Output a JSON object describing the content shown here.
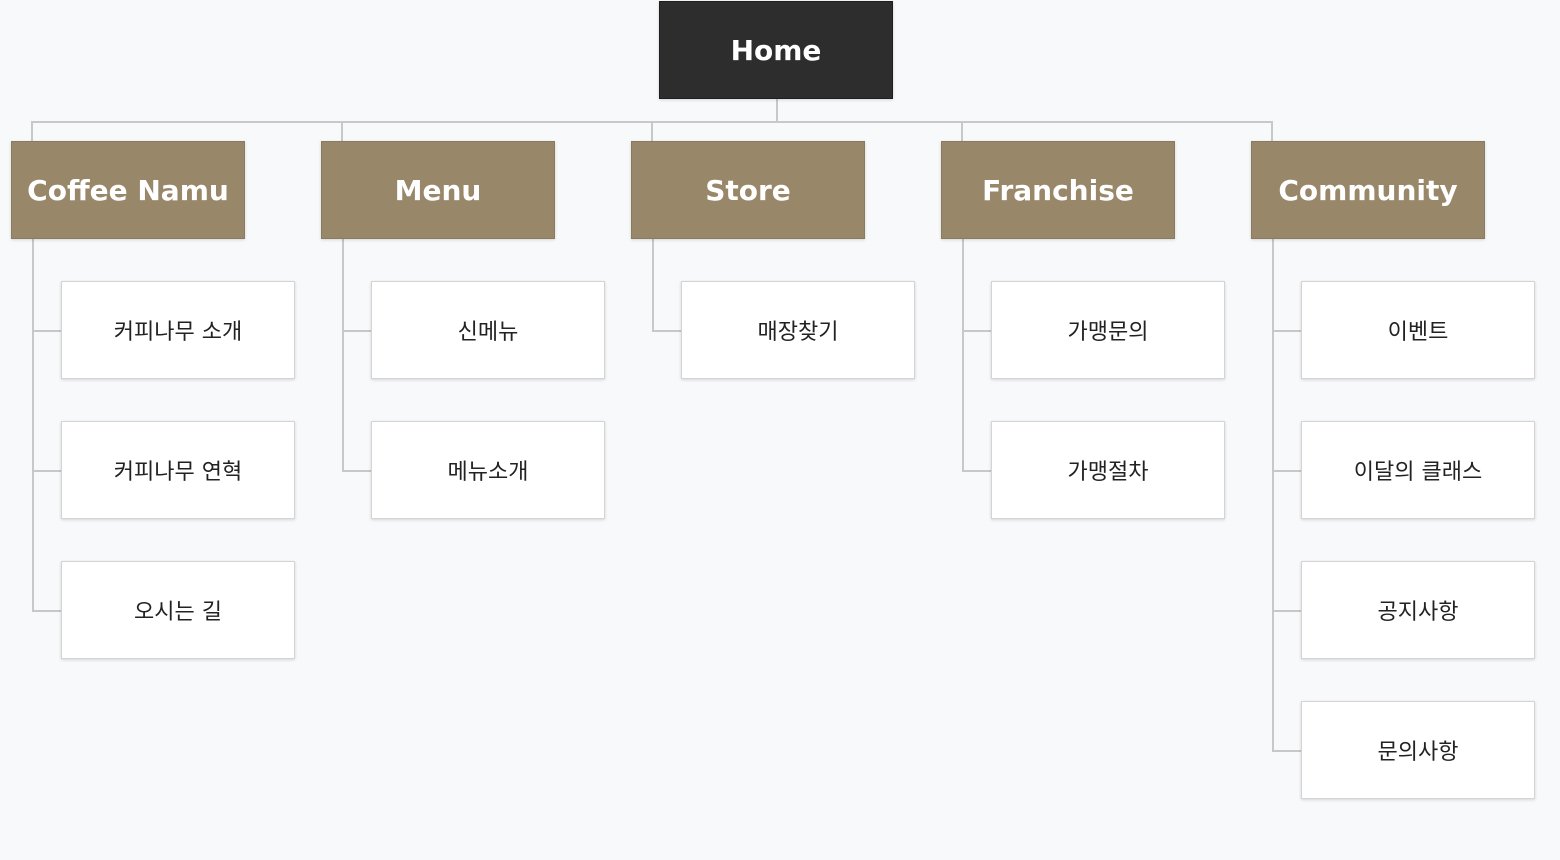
{
  "sitemap": {
    "root": {
      "label": "Home"
    },
    "sections": [
      {
        "label": "Coffee Namu",
        "pages": [
          "커피나무 소개",
          "커피나무 연혁",
          "오시는 길"
        ]
      },
      {
        "label": "Menu",
        "pages": [
          "신메뉴",
          "메뉴소개"
        ]
      },
      {
        "label": "Store",
        "pages": [
          "매장찾기"
        ]
      },
      {
        "label": "Franchise",
        "pages": [
          "가맹문의",
          "가맹절차"
        ]
      },
      {
        "label": "Community",
        "pages": [
          "이벤트",
          "이달의 클래스",
          "공지사항",
          "문의사항"
        ]
      }
    ]
  },
  "colors": {
    "root_fill": "#2d2d2d",
    "section_fill": "#998769",
    "page_fill": "#ffffff",
    "connector": "#c8c8c8",
    "background": "#f8f9fb"
  }
}
